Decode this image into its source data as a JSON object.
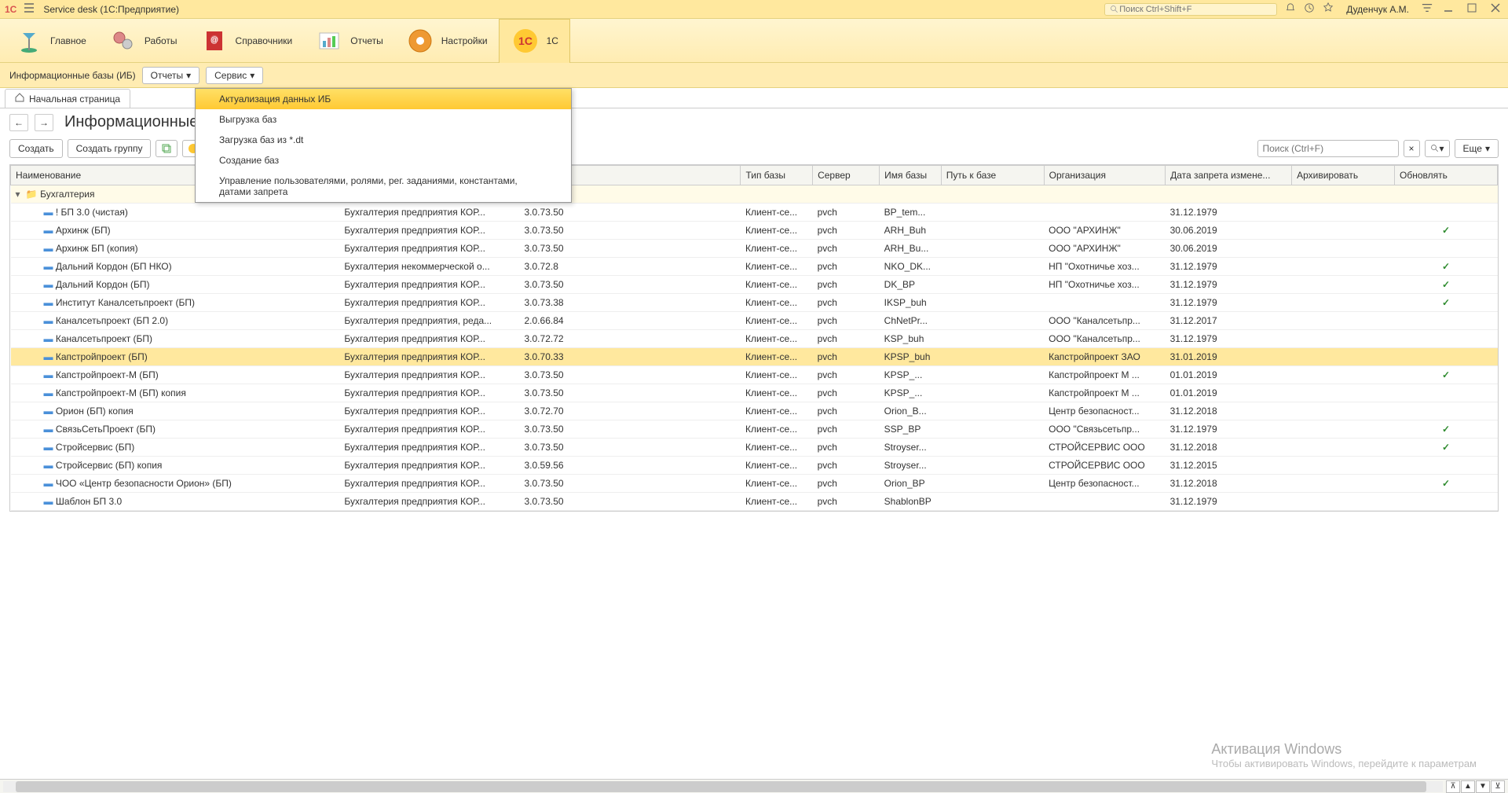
{
  "titlebar": {
    "logo": "1C",
    "title": "Service desk  (1С:Предприятие)",
    "search_placeholder": "Поиск Ctrl+Shift+F",
    "username": "Дуденчук А.М."
  },
  "navbar": {
    "items": [
      {
        "label": "Главное",
        "icon": "lamp"
      },
      {
        "label": "Работы",
        "icon": "gears"
      },
      {
        "label": "Справочники",
        "icon": "book"
      },
      {
        "label": "Отчеты",
        "icon": "chart"
      },
      {
        "label": "Настройки",
        "icon": "settings"
      },
      {
        "label": "1С",
        "icon": "1c",
        "active": true
      }
    ]
  },
  "subtoolbar": {
    "crumb": "Информационные базы (ИБ)",
    "reports_btn": "Отчеты",
    "service_btn": "Сервис"
  },
  "tab": {
    "label": "Начальная страница"
  },
  "page_title": "Информационные базы",
  "actions": {
    "create": "Создать",
    "create_group": "Создать группу",
    "more": "Еще",
    "search_placeholder": "Поиск (Ctrl+F)"
  },
  "service_menu": [
    "Актуализация данных ИБ",
    "Выгрузка баз",
    "Загрузка баз из *.dt",
    "Создание баз",
    "Управление пользователями, ролями, рег. заданиями, константами, датами запрета"
  ],
  "columns": [
    "Наименование",
    "",
    "",
    "Тип базы",
    "Сервер",
    "Имя базы",
    "Путь к базе",
    "Организация",
    "Дата запрета измене...",
    "Архивировать",
    "Обновлять"
  ],
  "group_row": "Бухгалтерия",
  "rows": [
    {
      "name": "! БП 3.0 (чистая)",
      "conf": "Бухгалтерия предприятия КОР...",
      "ver": "3.0.73.50",
      "type": "Клиент-се...",
      "srv": "pvch",
      "db": "BP_tem...",
      "path": "",
      "org": "",
      "date": "31.12.1979",
      "arch": "",
      "upd": ""
    },
    {
      "name": "Архинж (БП)",
      "conf": "Бухгалтерия предприятия КОР...",
      "ver": "3.0.73.50",
      "type": "Клиент-се...",
      "srv": "pvch",
      "db": "ARH_Buh",
      "path": "",
      "org": "ООО \"АРХИНЖ\"",
      "date": "30.06.2019",
      "arch": "",
      "upd": "✓"
    },
    {
      "name": "Архинж БП (копия)",
      "conf": "Бухгалтерия предприятия КОР...",
      "ver": "3.0.73.50",
      "type": "Клиент-се...",
      "srv": "pvch",
      "db": "ARH_Bu...",
      "path": "",
      "org": "ООО \"АРХИНЖ\"",
      "date": "30.06.2019",
      "arch": "",
      "upd": ""
    },
    {
      "name": "Дальний Кордон (БП НКО)",
      "conf": "Бухгалтерия некоммерческой о...",
      "ver": "3.0.72.8",
      "type": "Клиент-се...",
      "srv": "pvch",
      "db": "NKO_DK...",
      "path": "",
      "org": "НП \"Охотничье хоз...",
      "date": "31.12.1979",
      "arch": "",
      "upd": "✓"
    },
    {
      "name": "Дальний Кордон (БП)",
      "conf": "Бухгалтерия предприятия КОР...",
      "ver": "3.0.73.50",
      "type": "Клиент-се...",
      "srv": "pvch",
      "db": "DK_BP",
      "path": "",
      "org": "НП \"Охотничье хоз...",
      "date": "31.12.1979",
      "arch": "",
      "upd": "✓"
    },
    {
      "name": "Институт Каналсетьпроект (БП)",
      "conf": "Бухгалтерия предприятия КОР...",
      "ver": "3.0.73.38",
      "type": "Клиент-се...",
      "srv": "pvch",
      "db": "IKSP_buh",
      "path": "",
      "org": "",
      "date": "31.12.1979",
      "arch": "",
      "upd": "✓"
    },
    {
      "name": "Каналсетьпроект (БП 2.0)",
      "conf": "Бухгалтерия предприятия, реда...",
      "ver": "2.0.66.84",
      "type": "Клиент-се...",
      "srv": "pvch",
      "db": "ChNetPr...",
      "path": "",
      "org": "ООО \"Каналсетьпр...",
      "date": "31.12.2017",
      "arch": "",
      "upd": ""
    },
    {
      "name": "Каналсетьпроект (БП)",
      "conf": "Бухгалтерия предприятия КОР...",
      "ver": "3.0.72.72",
      "type": "Клиент-се...",
      "srv": "pvch",
      "db": "KSP_buh",
      "path": "",
      "org": "ООО \"Каналсетьпр...",
      "date": "31.12.1979",
      "arch": "",
      "upd": ""
    },
    {
      "name": "Капстройпроект (БП)",
      "conf": "Бухгалтерия предприятия КОР...",
      "ver": "3.0.70.33",
      "type": "Клиент-се...",
      "srv": "pvch",
      "db": "KPSP_buh",
      "path": "",
      "org": "Капстройпроект ЗАО",
      "date": "31.01.2019",
      "arch": "",
      "upd": "",
      "selected": true
    },
    {
      "name": "Капстройпроект-М (БП)",
      "conf": "Бухгалтерия предприятия КОР...",
      "ver": "3.0.73.50",
      "type": "Клиент-се...",
      "srv": "pvch",
      "db": "KPSP_...",
      "path": "",
      "org": "Капстройпроект М ...",
      "date": "01.01.2019",
      "arch": "",
      "upd": "✓"
    },
    {
      "name": "Капстройпроект-М (БП) копия",
      "conf": "Бухгалтерия предприятия КОР...",
      "ver": "3.0.73.50",
      "type": "Клиент-се...",
      "srv": "pvch",
      "db": "KPSP_...",
      "path": "",
      "org": "Капстройпроект М ...",
      "date": "01.01.2019",
      "arch": "",
      "upd": ""
    },
    {
      "name": "Орион (БП) копия",
      "conf": "Бухгалтерия предприятия КОР...",
      "ver": "3.0.72.70",
      "type": "Клиент-се...",
      "srv": "pvch",
      "db": "Orion_B...",
      "path": "",
      "org": "Центр безопасност...",
      "date": "31.12.2018",
      "arch": "",
      "upd": ""
    },
    {
      "name": "СвязьСетьПроект (БП)",
      "conf": "Бухгалтерия предприятия КОР...",
      "ver": "3.0.73.50",
      "type": "Клиент-се...",
      "srv": "pvch",
      "db": "SSP_BP",
      "path": "",
      "org": "ООО \"Связьсетьпр...",
      "date": "31.12.1979",
      "arch": "",
      "upd": "✓"
    },
    {
      "name": "Стройсервис (БП)",
      "conf": "Бухгалтерия предприятия КОР...",
      "ver": "3.0.73.50",
      "type": "Клиент-се...",
      "srv": "pvch",
      "db": "Stroyser...",
      "path": "",
      "org": "СТРОЙСЕРВИС ООО",
      "date": "31.12.2018",
      "arch": "",
      "upd": "✓"
    },
    {
      "name": "Стройсервис (БП) копия",
      "conf": "Бухгалтерия предприятия КОР...",
      "ver": "3.0.59.56",
      "type": "Клиент-се...",
      "srv": "pvch",
      "db": "Stroyser...",
      "path": "",
      "org": "СТРОЙСЕРВИС ООО",
      "date": "31.12.2015",
      "arch": "",
      "upd": ""
    },
    {
      "name": "ЧОО «Центр безопасности Орион» (БП)",
      "conf": "Бухгалтерия предприятия КОР...",
      "ver": "3.0.73.50",
      "type": "Клиент-се...",
      "srv": "pvch",
      "db": "Orion_BP",
      "path": "",
      "org": "Центр безопасност...",
      "date": "31.12.2018",
      "arch": "",
      "upd": "✓"
    },
    {
      "name": "Шаблон БП 3.0",
      "conf": "Бухгалтерия предприятия КОР...",
      "ver": "3.0.73.50",
      "type": "Клиент-се...",
      "srv": "pvch",
      "db": "ShablonBP",
      "path": "",
      "org": "",
      "date": "31.12.1979",
      "arch": "",
      "upd": ""
    }
  ],
  "watermark": {
    "title": "Активация Windows",
    "sub": "Чтобы активировать Windows, перейдите к параметрам"
  }
}
